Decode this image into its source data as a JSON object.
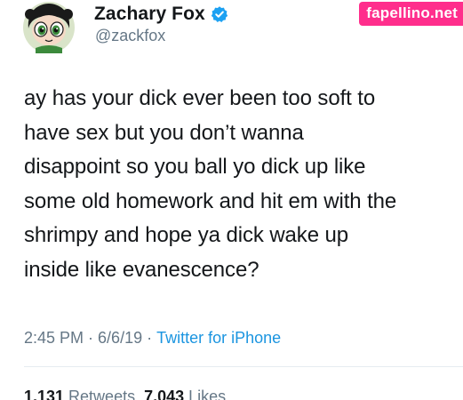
{
  "user": {
    "display_name": "Zachary Fox",
    "handle": "@zackfox",
    "verified": true,
    "avatar": "powerpuff-girl-avatar"
  },
  "watermark": {
    "text": "fapellino.net",
    "color": "#ff2e8c"
  },
  "tweet": {
    "text": "ay has your dick ever been too soft to\nhave sex but you don’t wanna\ndisappoint so you ball yo dick up like\nsome old homework and hit em with the\nshrimpy and hope ya dick wake up\ninside like evanescence?"
  },
  "meta": {
    "time": "2:45 PM",
    "separator1": " · ",
    "date": "6/6/19",
    "separator2": " · ",
    "source": "Twitter for iPhone"
  },
  "stats": {
    "retweets_count": "1,131",
    "retweets_label": "Retweets",
    "likes_count": "7,043",
    "likes_label": "Likes"
  },
  "colors": {
    "text": "#14171a",
    "secondary": "#657786",
    "link": "#1b95e0",
    "verified": "#1da1f2"
  }
}
